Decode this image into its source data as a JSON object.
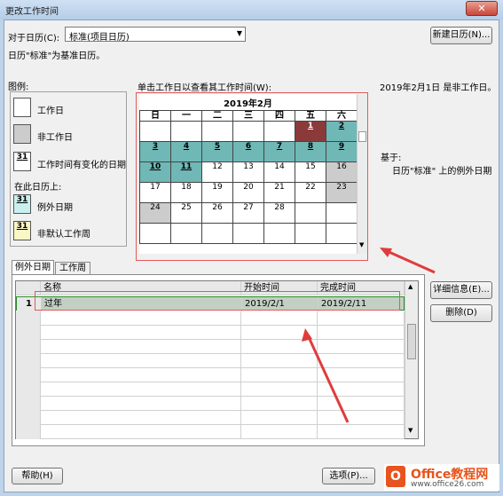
{
  "window": {
    "title": "更改工作时间",
    "close_glyph": "✕"
  },
  "for_calendar": {
    "label": "对于日历(C):",
    "value": "标准(项目日历)",
    "new_button": "新建日历(N)..."
  },
  "base_note": "日历\"标准\"为基准日历。",
  "legend": {
    "title": "图例:",
    "working_day": "工作日",
    "nonworking_day": "非工作日",
    "changed_day": "工作时间有变化的日期",
    "on_this_calendar": "在此日历上:",
    "exception_day": "例外日期",
    "nondefault_week": "非默认工作周",
    "swatch_num": "31"
  },
  "calendar": {
    "instruction": "单击工作日以查看其工作时间(W):",
    "month_title": "2019年2月",
    "weekdays": [
      "日",
      "一",
      "二",
      "三",
      "四",
      "五",
      "六"
    ],
    "rows": [
      [
        "",
        "",
        "",
        "",
        "",
        "1",
        "2"
      ],
      [
        "3",
        "4",
        "5",
        "6",
        "7",
        "8",
        "9"
      ],
      [
        "10",
        "11",
        "12",
        "13",
        "14",
        "15",
        "16"
      ],
      [
        "17",
        "18",
        "19",
        "20",
        "21",
        "22",
        "23"
      ],
      [
        "24",
        "25",
        "26",
        "27",
        "28",
        "",
        ""
      ],
      [
        "",
        "",
        "",
        "",
        "",
        "",
        ""
      ]
    ],
    "types": [
      [
        "w",
        "w",
        "w",
        "w",
        "w",
        "sel",
        "exc"
      ],
      [
        "exc",
        "exc",
        "exc",
        "exc",
        "exc",
        "exc",
        "exc"
      ],
      [
        "exc",
        "exc",
        "w",
        "w",
        "w",
        "w",
        "nw"
      ],
      [
        "w",
        "w",
        "w",
        "w",
        "w",
        "w",
        "nw"
      ],
      [
        "nw",
        "w",
        "w",
        "w",
        "w",
        "w",
        "w"
      ],
      [
        "w",
        "w",
        "w",
        "w",
        "w",
        "w",
        "w"
      ]
    ]
  },
  "info": {
    "date_status": "2019年2月1日 是非工作日。",
    "based_on": "基于:",
    "based_detail": "日历\"标准\" 上的例外日期"
  },
  "tabs": [
    "例外日期",
    "工作周"
  ],
  "table": {
    "headers": [
      "名称",
      "开始时间",
      "完成时间"
    ],
    "rows": [
      {
        "num": "1",
        "name": "过年",
        "start": "2019/2/1",
        "end": "2019/2/11"
      }
    ]
  },
  "side_buttons": {
    "details": "详细信息(E)...",
    "delete": "删除(D)"
  },
  "bottom": {
    "help": "帮助(H)",
    "options": "选项(P)..."
  },
  "watermark": {
    "brand": "Office教程网",
    "url": "www.office26.com"
  },
  "colors": {
    "exception": "#6fb8b6",
    "nonworking": "#cccccc",
    "selected": "#8b3a3a",
    "annotation": "#e03c3c"
  }
}
